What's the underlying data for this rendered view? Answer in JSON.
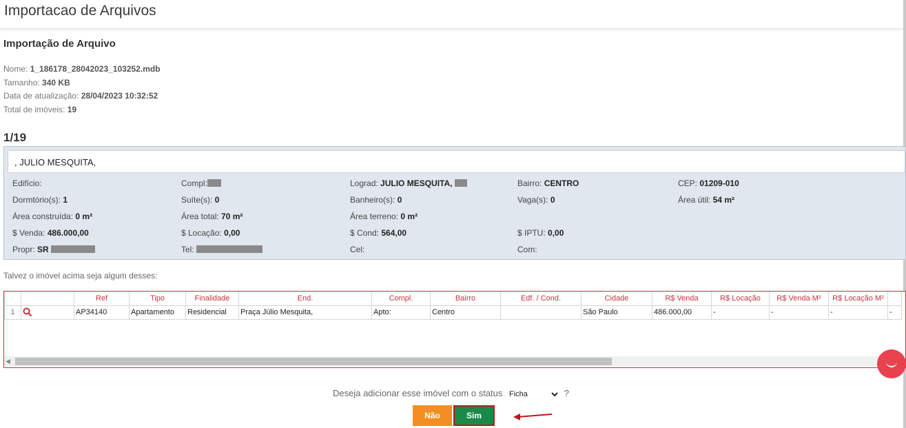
{
  "page": {
    "title": "Importacao de Arquivos"
  },
  "file": {
    "section_title": "Importação de Arquivo",
    "name_label": "Nome:",
    "name": "1_186178_28042023_103252.mdb",
    "size_label": "Tamanho:",
    "size": "340 KB",
    "updated_label": "Data de atualização:",
    "updated": "28/04/2023 10:32:52",
    "total_label": "Total de imóveis:",
    "total": "19"
  },
  "counter": "1/19",
  "property": {
    "address": ", JULIO MESQUITA,",
    "edificio_label": "Edifício:",
    "edificio": "",
    "compl_label": "Compl:",
    "lograd_label": "Lograd:",
    "lograd": "JULIO MESQUITA,",
    "bairro_label": "Bairro:",
    "bairro": "CENTRO",
    "cep_label": "CEP:",
    "cep": "01209-010",
    "dormitorios_label": "Dormtório(s):",
    "dormitorios": "1",
    "suites_label": "Suíte(s):",
    "suites": "0",
    "banheiros_label": "Banheiro(s):",
    "banheiros": "0",
    "vagas_label": "Vaga(s):",
    "vagas": "0",
    "area_util_label": "Área útil:",
    "area_util": "54 m²",
    "area_construida_label": "Área construída:",
    "area_construida": "0 m²",
    "area_total_label": "Área total:",
    "area_total": "70 m²",
    "area_terreno_label": "Área terreno:",
    "area_terreno": "0 m²",
    "venda_label": "$ Venda:",
    "venda": "486.000,00",
    "locacao_label": "$ Locação:",
    "locacao": "0,00",
    "cond_label": "$ Cond:",
    "cond": "564,00",
    "iptu_label": "$ IPTU:",
    "iptu": "0,00",
    "propr_label": "Propr:",
    "propr": "SR",
    "tel_label": "Tel:",
    "cel_label": "Cel:",
    "com_label": "Com:"
  },
  "matches": {
    "hint": "Talvez o imóvel acima seja algum desses:",
    "columns": [
      "",
      "",
      "Ref",
      "Tipo",
      "Finalidade",
      "End.",
      "Compl.",
      "Bairro",
      "Edf. / Cond.",
      "Cidade",
      "R$ Venda",
      "R$ Locação",
      "R$ Venda M²",
      "R$ Locação M²",
      ""
    ],
    "rows": [
      [
        "1",
        "",
        "AP34140",
        "Apartamento",
        "Residencial",
        "Praça Júlio Mesquita,",
        "Apto:",
        "Centro",
        "",
        "São Paulo",
        "486.000,00",
        "-",
        "-",
        "-",
        "-"
      ]
    ]
  },
  "confirm": {
    "question": "Deseja adicionar esse imóvel com o status",
    "status_selected": "Ficha",
    "question_mark": "?",
    "no_label": "Não",
    "yes_label": "Sim"
  },
  "colors": {
    "accent_red": "#c8323c",
    "yes_green": "#1a8a4b",
    "no_orange": "#f28f23",
    "card_bg": "#e1e7ee"
  },
  "icons": {
    "search": "magnifier-icon",
    "chat": "chat-icon",
    "annotation": "arrow-left-icon"
  }
}
